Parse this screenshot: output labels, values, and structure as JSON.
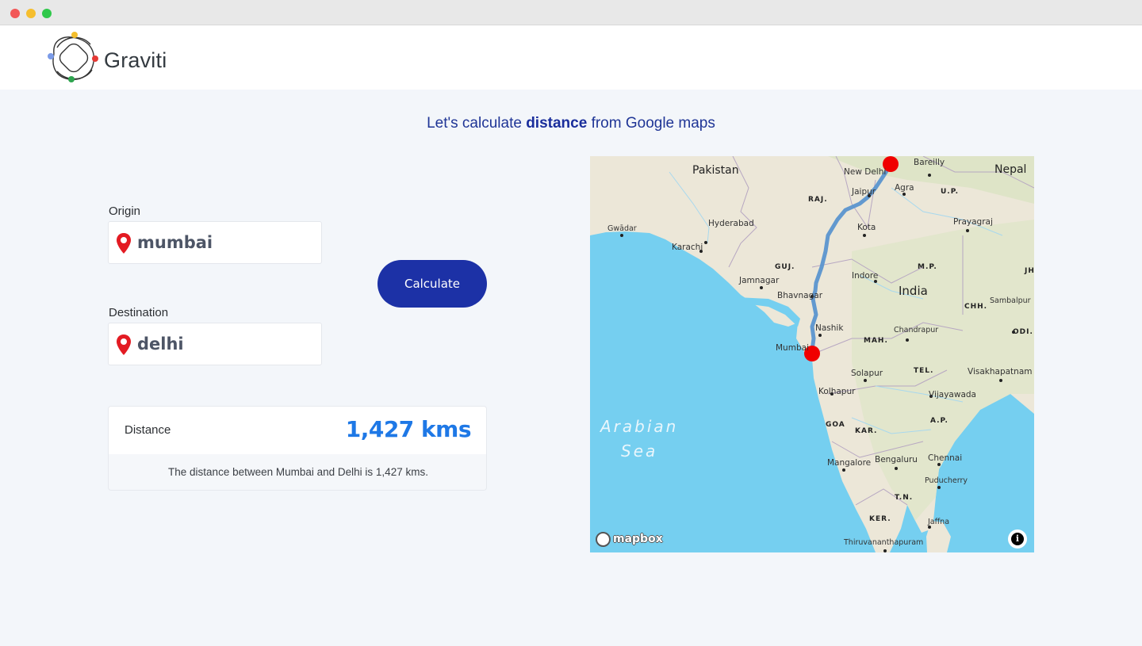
{
  "app": {
    "brand": "Graviti"
  },
  "page": {
    "heading_pre": "Let's calculate ",
    "heading_bold": "distance",
    "heading_post": " from Google maps"
  },
  "form": {
    "origin_label": "Origin",
    "origin_value": "mumbai",
    "destination_label": "Destination",
    "destination_value": "delhi",
    "calculate_label": "Calculate"
  },
  "result": {
    "label": "Distance",
    "value": "1,427 kms",
    "sentence": "The distance between Mumbai and Delhi is 1,427 kms."
  },
  "map": {
    "attribution": "mapbox",
    "info_icon": "info-icon",
    "labels": {
      "pakistan": "Pakistan",
      "nepal": "Nepal",
      "india": "India",
      "new_delhi": "New Delhi",
      "bareilly": "Bareilly",
      "agra": "Agra",
      "jaipur": "Jaipur",
      "raj": "RAJ.",
      "up": "U.P.",
      "prayagraj": "Prayagraj",
      "kota": "Kota",
      "gwadar": "Gwādar",
      "hyderabad": "Hyderabad",
      "karachi": "Karachi",
      "guj": "GUJ.",
      "mp": "M.P.",
      "jh": "JH",
      "jamnagar": "Jamnagar",
      "indore": "Indore",
      "bhavnagar": "Bhavnagar",
      "chh": "CHH.",
      "sambalpur": "Sambalpur",
      "nashik": "Nashik",
      "chandrapur": "Chandrapur",
      "odi": "ODI.",
      "mumbai": "Mumbai",
      "mah": "MAH.",
      "solapur": "Solapur",
      "tel": "TEL.",
      "visakhapatnam": "Visakhapatnam",
      "kolhapur": "Kolhapur",
      "vijayawada": "Vijayawada",
      "arabian": "Arabian",
      "sea": "Sea",
      "goa": "GOA",
      "kar": "KAR.",
      "ap": "A.P.",
      "mangalore": "Mangalore",
      "bengaluru": "Bengaluru",
      "chennai": "Chennai",
      "puducherry": "Puducherry",
      "tn": "T.N.",
      "ker": "KER.",
      "jaffna": "Jaffna",
      "thiruvananthapuram": "Thiruvananthapuram"
    },
    "colors": {
      "water": "#75cff0",
      "land": "#eae6d8",
      "route": "#5b95cf",
      "marker": "#f00000"
    }
  },
  "colors": {
    "primary": "#1c31a6",
    "accent": "#1e78e6",
    "background": "#f3f6fa"
  }
}
